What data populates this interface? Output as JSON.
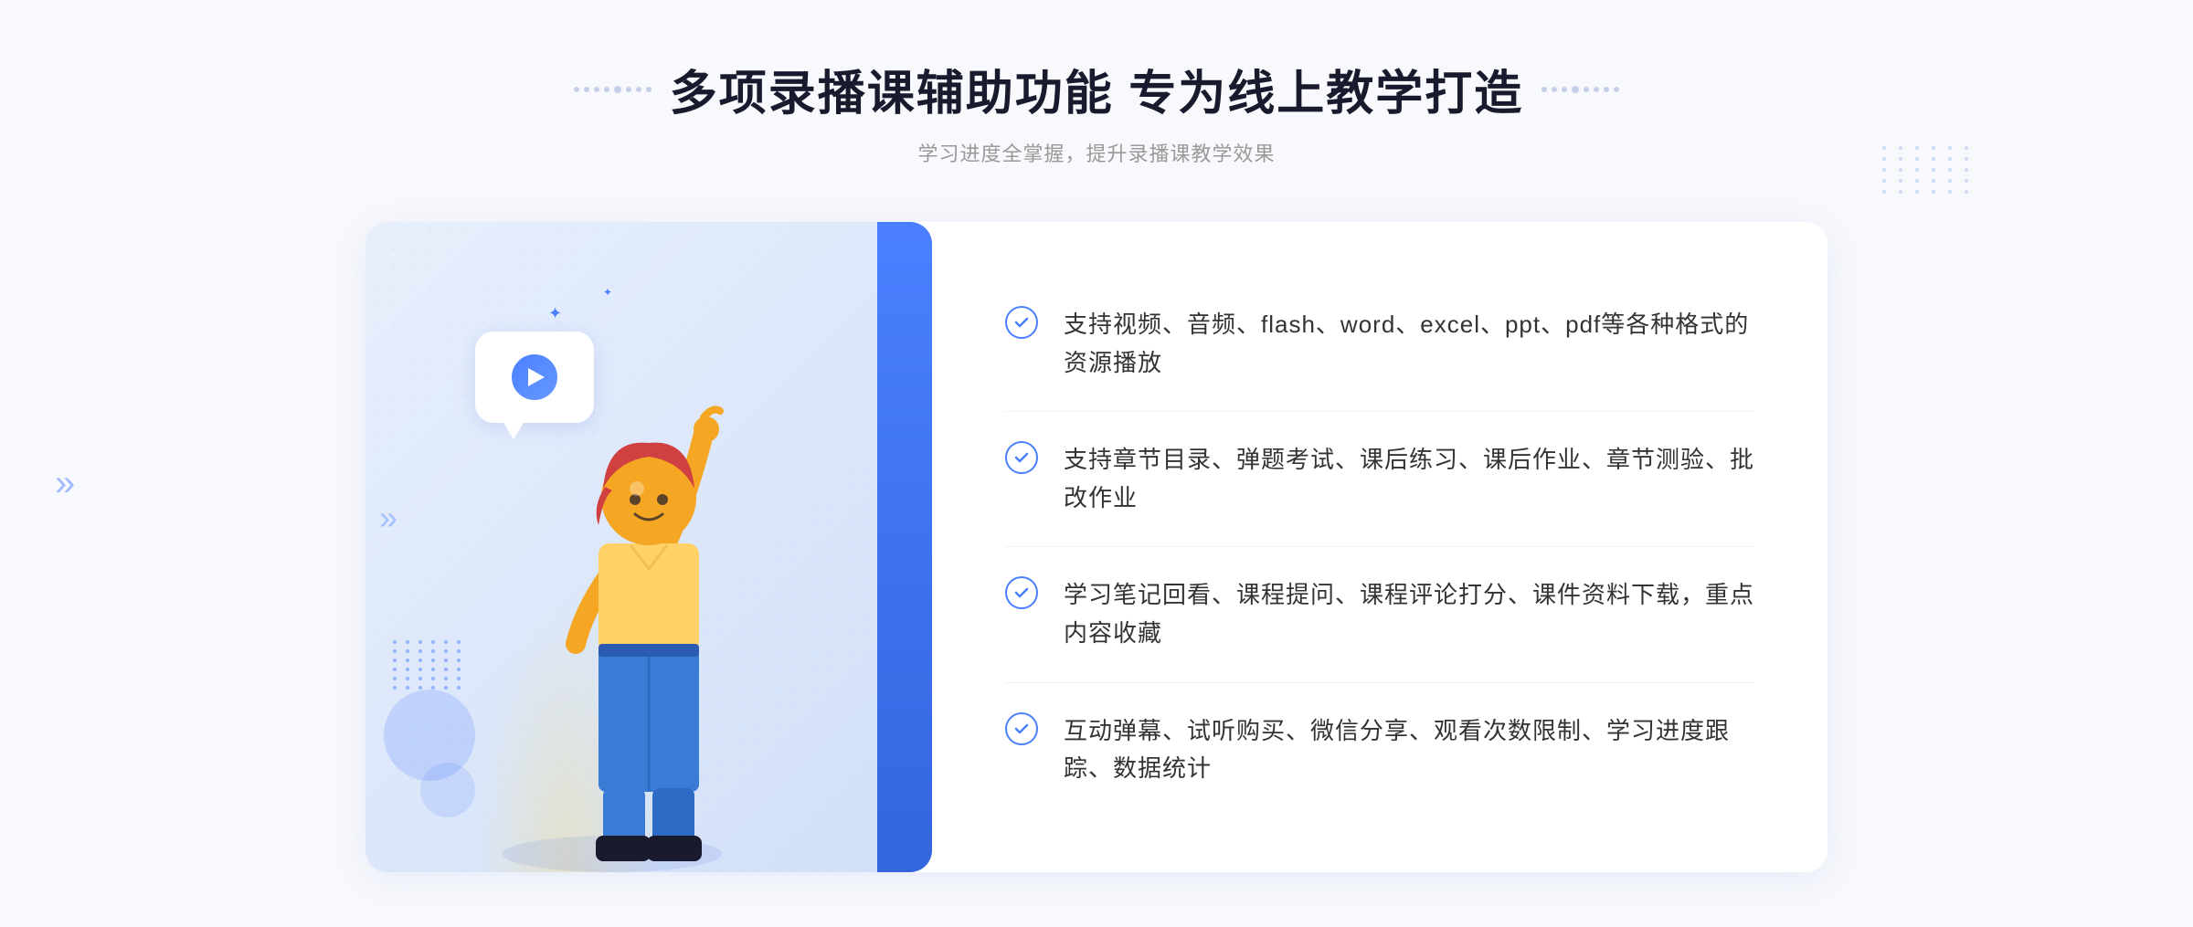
{
  "header": {
    "title": "多项录播课辅助功能 专为线上教学打造",
    "subtitle": "学习进度全掌握，提升录播课教学效果",
    "deco_left": "❋",
    "deco_right": "❋"
  },
  "features": [
    {
      "id": 1,
      "text": "支持视频、音频、flash、word、excel、ppt、pdf等各种格式的资源播放"
    },
    {
      "id": 2,
      "text": "支持章节目录、弹题考试、课后练习、课后作业、章节测验、批改作业"
    },
    {
      "id": 3,
      "text": "学习笔记回看、课程提问、课程评论打分、课件资料下载，重点内容收藏"
    },
    {
      "id": 4,
      "text": "互动弹幕、试听购买、微信分享、观看次数限制、学习进度跟踪、数据统计"
    }
  ],
  "colors": {
    "primary": "#4a7fff",
    "title": "#1a1a2e",
    "text": "#333333",
    "subtitle": "#999999",
    "border": "#f0f2f8",
    "bg": "#f8f9fc"
  }
}
